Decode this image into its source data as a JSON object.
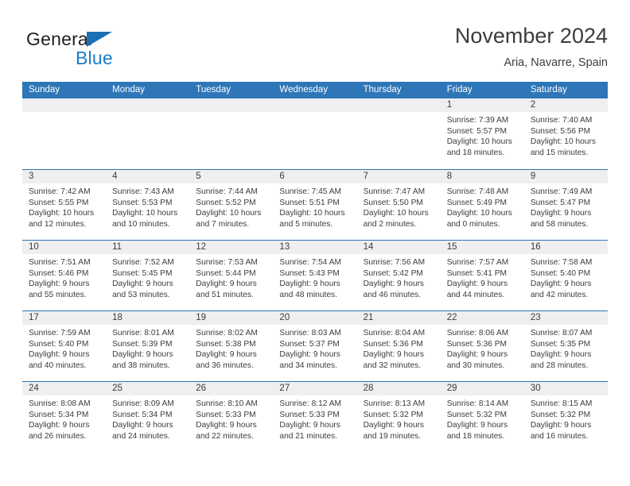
{
  "brand": {
    "word_one": "General",
    "word_two": "Blue",
    "triangle_color": "#1a6fb5",
    "blue_text_color": "#1a7ec8"
  },
  "header": {
    "title": "November 2024",
    "subtitle": "Aria, Navarre, Spain"
  },
  "theme": {
    "header_blue": "#2e76b8",
    "number_band_gray": "#efefef",
    "text_color": "#3c3c3c"
  },
  "weekday_headers": [
    "Sunday",
    "Monday",
    "Tuesday",
    "Wednesday",
    "Thursday",
    "Friday",
    "Saturday"
  ],
  "labels": {
    "sunrise_prefix": "Sunrise:",
    "sunset_prefix": "Sunset:",
    "daylight_prefix": "Daylight:"
  },
  "weeks": [
    [
      {
        "day": "",
        "empty": true,
        "sunrise": "",
        "sunset": "",
        "daylight_line1": "",
        "daylight_line2": ""
      },
      {
        "day": "",
        "empty": true,
        "sunrise": "",
        "sunset": "",
        "daylight_line1": "",
        "daylight_line2": ""
      },
      {
        "day": "",
        "empty": true,
        "sunrise": "",
        "sunset": "",
        "daylight_line1": "",
        "daylight_line2": ""
      },
      {
        "day": "",
        "empty": true,
        "sunrise": "",
        "sunset": "",
        "daylight_line1": "",
        "daylight_line2": ""
      },
      {
        "day": "",
        "empty": true,
        "sunrise": "",
        "sunset": "",
        "daylight_line1": "",
        "daylight_line2": ""
      },
      {
        "day": "1",
        "empty": false,
        "sunrise": "Sunrise: 7:39 AM",
        "sunset": "Sunset: 5:57 PM",
        "daylight_line1": "Daylight: 10 hours",
        "daylight_line2": "and 18 minutes."
      },
      {
        "day": "2",
        "empty": false,
        "sunrise": "Sunrise: 7:40 AM",
        "sunset": "Sunset: 5:56 PM",
        "daylight_line1": "Daylight: 10 hours",
        "daylight_line2": "and 15 minutes."
      }
    ],
    [
      {
        "day": "3",
        "empty": false,
        "sunrise": "Sunrise: 7:42 AM",
        "sunset": "Sunset: 5:55 PM",
        "daylight_line1": "Daylight: 10 hours",
        "daylight_line2": "and 12 minutes."
      },
      {
        "day": "4",
        "empty": false,
        "sunrise": "Sunrise: 7:43 AM",
        "sunset": "Sunset: 5:53 PM",
        "daylight_line1": "Daylight: 10 hours",
        "daylight_line2": "and 10 minutes."
      },
      {
        "day": "5",
        "empty": false,
        "sunrise": "Sunrise: 7:44 AM",
        "sunset": "Sunset: 5:52 PM",
        "daylight_line1": "Daylight: 10 hours",
        "daylight_line2": "and 7 minutes."
      },
      {
        "day": "6",
        "empty": false,
        "sunrise": "Sunrise: 7:45 AM",
        "sunset": "Sunset: 5:51 PM",
        "daylight_line1": "Daylight: 10 hours",
        "daylight_line2": "and 5 minutes."
      },
      {
        "day": "7",
        "empty": false,
        "sunrise": "Sunrise: 7:47 AM",
        "sunset": "Sunset: 5:50 PM",
        "daylight_line1": "Daylight: 10 hours",
        "daylight_line2": "and 2 minutes."
      },
      {
        "day": "8",
        "empty": false,
        "sunrise": "Sunrise: 7:48 AM",
        "sunset": "Sunset: 5:49 PM",
        "daylight_line1": "Daylight: 10 hours",
        "daylight_line2": "and 0 minutes."
      },
      {
        "day": "9",
        "empty": false,
        "sunrise": "Sunrise: 7:49 AM",
        "sunset": "Sunset: 5:47 PM",
        "daylight_line1": "Daylight: 9 hours",
        "daylight_line2": "and 58 minutes."
      }
    ],
    [
      {
        "day": "10",
        "empty": false,
        "sunrise": "Sunrise: 7:51 AM",
        "sunset": "Sunset: 5:46 PM",
        "daylight_line1": "Daylight: 9 hours",
        "daylight_line2": "and 55 minutes."
      },
      {
        "day": "11",
        "empty": false,
        "sunrise": "Sunrise: 7:52 AM",
        "sunset": "Sunset: 5:45 PM",
        "daylight_line1": "Daylight: 9 hours",
        "daylight_line2": "and 53 minutes."
      },
      {
        "day": "12",
        "empty": false,
        "sunrise": "Sunrise: 7:53 AM",
        "sunset": "Sunset: 5:44 PM",
        "daylight_line1": "Daylight: 9 hours",
        "daylight_line2": "and 51 minutes."
      },
      {
        "day": "13",
        "empty": false,
        "sunrise": "Sunrise: 7:54 AM",
        "sunset": "Sunset: 5:43 PM",
        "daylight_line1": "Daylight: 9 hours",
        "daylight_line2": "and 48 minutes."
      },
      {
        "day": "14",
        "empty": false,
        "sunrise": "Sunrise: 7:56 AM",
        "sunset": "Sunset: 5:42 PM",
        "daylight_line1": "Daylight: 9 hours",
        "daylight_line2": "and 46 minutes."
      },
      {
        "day": "15",
        "empty": false,
        "sunrise": "Sunrise: 7:57 AM",
        "sunset": "Sunset: 5:41 PM",
        "daylight_line1": "Daylight: 9 hours",
        "daylight_line2": "and 44 minutes."
      },
      {
        "day": "16",
        "empty": false,
        "sunrise": "Sunrise: 7:58 AM",
        "sunset": "Sunset: 5:40 PM",
        "daylight_line1": "Daylight: 9 hours",
        "daylight_line2": "and 42 minutes."
      }
    ],
    [
      {
        "day": "17",
        "empty": false,
        "sunrise": "Sunrise: 7:59 AM",
        "sunset": "Sunset: 5:40 PM",
        "daylight_line1": "Daylight: 9 hours",
        "daylight_line2": "and 40 minutes."
      },
      {
        "day": "18",
        "empty": false,
        "sunrise": "Sunrise: 8:01 AM",
        "sunset": "Sunset: 5:39 PM",
        "daylight_line1": "Daylight: 9 hours",
        "daylight_line2": "and 38 minutes."
      },
      {
        "day": "19",
        "empty": false,
        "sunrise": "Sunrise: 8:02 AM",
        "sunset": "Sunset: 5:38 PM",
        "daylight_line1": "Daylight: 9 hours",
        "daylight_line2": "and 36 minutes."
      },
      {
        "day": "20",
        "empty": false,
        "sunrise": "Sunrise: 8:03 AM",
        "sunset": "Sunset: 5:37 PM",
        "daylight_line1": "Daylight: 9 hours",
        "daylight_line2": "and 34 minutes."
      },
      {
        "day": "21",
        "empty": false,
        "sunrise": "Sunrise: 8:04 AM",
        "sunset": "Sunset: 5:36 PM",
        "daylight_line1": "Daylight: 9 hours",
        "daylight_line2": "and 32 minutes."
      },
      {
        "day": "22",
        "empty": false,
        "sunrise": "Sunrise: 8:06 AM",
        "sunset": "Sunset: 5:36 PM",
        "daylight_line1": "Daylight: 9 hours",
        "daylight_line2": "and 30 minutes."
      },
      {
        "day": "23",
        "empty": false,
        "sunrise": "Sunrise: 8:07 AM",
        "sunset": "Sunset: 5:35 PM",
        "daylight_line1": "Daylight: 9 hours",
        "daylight_line2": "and 28 minutes."
      }
    ],
    [
      {
        "day": "24",
        "empty": false,
        "sunrise": "Sunrise: 8:08 AM",
        "sunset": "Sunset: 5:34 PM",
        "daylight_line1": "Daylight: 9 hours",
        "daylight_line2": "and 26 minutes."
      },
      {
        "day": "25",
        "empty": false,
        "sunrise": "Sunrise: 8:09 AM",
        "sunset": "Sunset: 5:34 PM",
        "daylight_line1": "Daylight: 9 hours",
        "daylight_line2": "and 24 minutes."
      },
      {
        "day": "26",
        "empty": false,
        "sunrise": "Sunrise: 8:10 AM",
        "sunset": "Sunset: 5:33 PM",
        "daylight_line1": "Daylight: 9 hours",
        "daylight_line2": "and 22 minutes."
      },
      {
        "day": "27",
        "empty": false,
        "sunrise": "Sunrise: 8:12 AM",
        "sunset": "Sunset: 5:33 PM",
        "daylight_line1": "Daylight: 9 hours",
        "daylight_line2": "and 21 minutes."
      },
      {
        "day": "28",
        "empty": false,
        "sunrise": "Sunrise: 8:13 AM",
        "sunset": "Sunset: 5:32 PM",
        "daylight_line1": "Daylight: 9 hours",
        "daylight_line2": "and 19 minutes."
      },
      {
        "day": "29",
        "empty": false,
        "sunrise": "Sunrise: 8:14 AM",
        "sunset": "Sunset: 5:32 PM",
        "daylight_line1": "Daylight: 9 hours",
        "daylight_line2": "and 18 minutes."
      },
      {
        "day": "30",
        "empty": false,
        "sunrise": "Sunrise: 8:15 AM",
        "sunset": "Sunset: 5:32 PM",
        "daylight_line1": "Daylight: 9 hours",
        "daylight_line2": "and 16 minutes."
      }
    ]
  ]
}
